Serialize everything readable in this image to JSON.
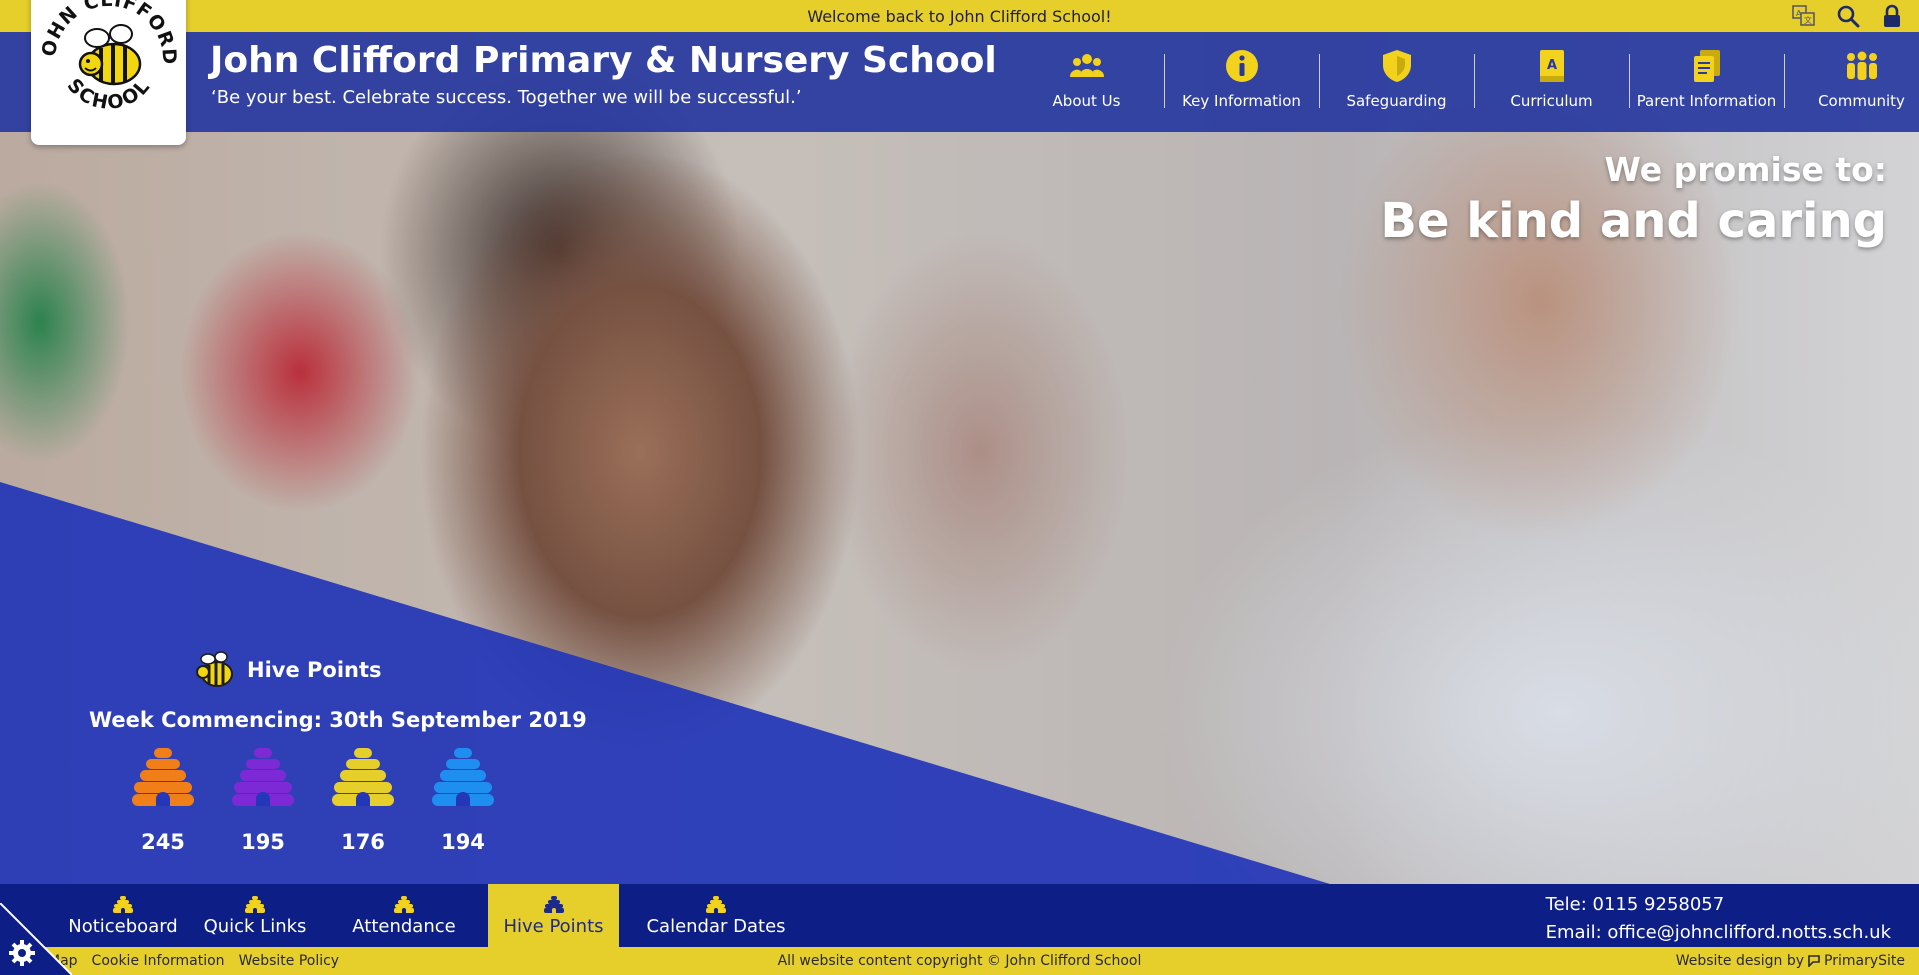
{
  "topbar": {
    "welcome": "Welcome back to John Clifford School!",
    "icons": [
      "translate-icon",
      "search-icon",
      "lock-icon"
    ]
  },
  "logo": {
    "alt": "JOHN CLIFFORD SCHOOL",
    "top_text": "JOHN CLIFFORD",
    "bottom_text": "SCHOOL"
  },
  "header": {
    "title": "John Clifford Primary & Nursery School",
    "motto": "‘Be your best. Celebrate success. Together we will be successful.’"
  },
  "nav": {
    "items": [
      {
        "label": "About Us",
        "icon": "people-icon"
      },
      {
        "label": "Key Information",
        "icon": "info-icon"
      },
      {
        "label": "Safeguarding",
        "icon": "shield-icon"
      },
      {
        "label": "Curriculum",
        "icon": "book-icon"
      },
      {
        "label": "Parent Information",
        "icon": "documents-icon"
      },
      {
        "label": "Community",
        "icon": "group-icon"
      }
    ]
  },
  "hero": {
    "promise_line1": "We promise to:",
    "promise_line2": "Be kind and caring"
  },
  "hive_points": {
    "title": "Hive Points",
    "week": "Week Commencing: 30th September 2019",
    "hives": [
      {
        "value": "245",
        "color": "#f07f1a"
      },
      {
        "value": "195",
        "color": "#7d2ad6"
      },
      {
        "value": "176",
        "color": "#e6cf2b"
      },
      {
        "value": "194",
        "color": "#1e8ff0"
      }
    ]
  },
  "quicklinks": {
    "items": [
      {
        "label": "Noticeboard",
        "active": false
      },
      {
        "label": "Quick Links",
        "active": false
      },
      {
        "label": "Attendance",
        "active": false
      },
      {
        "label": "Hive Points",
        "active": true
      },
      {
        "label": "Calendar Dates",
        "active": false
      }
    ]
  },
  "contact": {
    "tel": "Tele: 0115 9258057",
    "email": "Email: office@johnclifford.notts.sch.uk"
  },
  "footer": {
    "links": [
      "Map",
      "Cookie Information",
      "Website Policy"
    ],
    "copyright": "All website content copyright © John Clifford School",
    "design": "Website design by",
    "designer": "PrimarySite"
  },
  "colors": {
    "yellow": "#e6cf2b",
    "navy": "#0d1f86",
    "header_blue": "#2738a0"
  }
}
